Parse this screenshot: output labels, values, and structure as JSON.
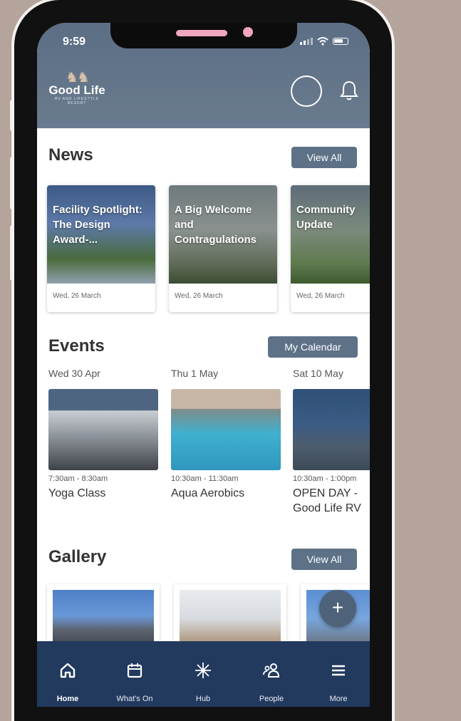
{
  "status": {
    "time": "9:59"
  },
  "header": {
    "logo_name": "Good Life",
    "logo_tagline": "RV AND LIFESTYLE RESORT"
  },
  "news": {
    "title": "News",
    "action": "View All",
    "cards": [
      {
        "title": "Facility Spotlight: The Design Award-...",
        "date": "Wed, 26 March"
      },
      {
        "title": "A Big Welcome and Contragulations",
        "date": "Wed, 26 March"
      },
      {
        "title": "Community Update",
        "date": "Wed, 26 March"
      }
    ]
  },
  "events": {
    "title": "Events",
    "action": "My Calendar",
    "items": [
      {
        "date": "Wed 30 Apr",
        "time": "7:30am - 8:30am",
        "title": "Yoga Class"
      },
      {
        "date": "Thu 1 May",
        "time": "10:30am - 11:30am",
        "title": "Aqua Aerobics"
      },
      {
        "date": "Sat 10 May",
        "time": "10:30am - 1:00pm",
        "title": "OPEN DAY - Good Life RV and Lifestyle"
      }
    ]
  },
  "gallery": {
    "title": "Gallery",
    "action": "View All"
  },
  "fab": {
    "label": "+"
  },
  "tabbar": {
    "items": [
      {
        "label": "Home",
        "icon": "home-icon"
      },
      {
        "label": "What's On",
        "icon": "calendar-icon"
      },
      {
        "label": "Hub",
        "icon": "hub-icon"
      },
      {
        "label": "People",
        "icon": "people-icon"
      },
      {
        "label": "More",
        "icon": "menu-icon"
      }
    ]
  },
  "colors": {
    "header": "#5c6e84",
    "button": "#5d7187",
    "tabbar": "#223a5e",
    "background": "#b4a49b"
  }
}
